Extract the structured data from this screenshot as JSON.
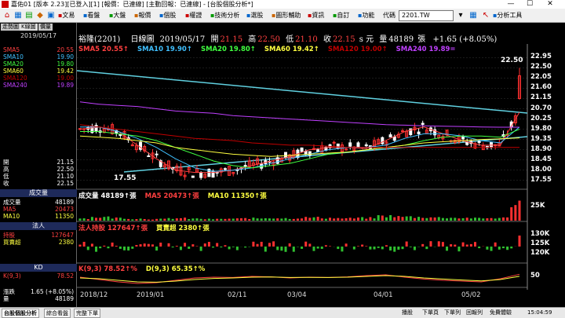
{
  "titlebar": {
    "title": "嘉佑01 [版本 2.23][已登入][1] [報價：已連線] [主動回報：已連線] - [台股個股分析*]",
    "min": "—",
    "max": "☐",
    "close": "✕"
  },
  "toolbar": {
    "menus": [
      "文易",
      "看盤",
      "大盤",
      "報價",
      "個股",
      "權證",
      "技術分析",
      "選股",
      "圖形輔助",
      "資訊",
      "自訂",
      "功能",
      "代碼"
    ],
    "code_value": "2201.TW",
    "analysis_tools": "分析工具"
  },
  "left": {
    "tabs": [
      "走勢圖",
      "K線圖",
      "價量"
    ],
    "date": "2019/05/17",
    "sma": [
      {
        "label": "SMA5",
        "value": "20.55",
        "color": "#ff4040"
      },
      {
        "label": "SMA10",
        "value": "19.90",
        "color": "#40c0ff"
      },
      {
        "label": "SMA20",
        "value": "19.80",
        "color": "#40ff40"
      },
      {
        "label": "SMA60",
        "value": "19.42",
        "color": "#ffff40"
      },
      {
        "label": "SMA120",
        "value": "19.00",
        "color": "#c00000"
      },
      {
        "label": "SMA240",
        "value": "19.89",
        "color": "#c040ff"
      }
    ],
    "ohlc": [
      {
        "label": "開",
        "value": "21.15"
      },
      {
        "label": "高",
        "value": "22.50"
      },
      {
        "label": "低",
        "value": "21.10"
      },
      {
        "label": "收",
        "value": "22.15"
      }
    ],
    "vol_head": "成交量",
    "vol_rows": [
      {
        "label": "成交量",
        "value": "48189",
        "color": "#ffffff"
      },
      {
        "label": "MA5",
        "value": "20473",
        "color": "#ff4040"
      },
      {
        "label": "MA10",
        "value": "11350",
        "color": "#ffff40"
      }
    ],
    "inst_head": "法人",
    "inst_rows": [
      {
        "label": "持股",
        "value": "127647",
        "color": "#ff4040"
      },
      {
        "label": "買賣超",
        "value": "2380",
        "color": "#ffff40"
      }
    ],
    "kd_head": "KD",
    "kd_rows": [
      {
        "label": "K(9,3)",
        "value": "78.52",
        "color": "#ff4040"
      }
    ],
    "bottom_rows": [
      {
        "label": "漲跌",
        "value": "1.65 (+8.05%)"
      },
      {
        "label": "量",
        "value": "48189"
      }
    ]
  },
  "chart_header": {
    "stock": "裕隆(2201)",
    "type": "日線圖",
    "date": "2019/05/17",
    "open_label": "開",
    "open": "21.15",
    "high_label": "高",
    "high": "22.50",
    "low_label": "低",
    "low": "21.10",
    "close_label": "收",
    "close": "22.15",
    "unit": "s 元",
    "vol_label": "量",
    "vol": "48189",
    "vol_unit": "張",
    "change": "+1.65 (+8.05%)"
  },
  "legends": {
    "sma": [
      {
        "text": "SMA5 20.55↑",
        "color": "#ff4040"
      },
      {
        "text": "SMA10 19.90↑",
        "color": "#40c0ff"
      },
      {
        "text": "SMA20 19.80↑",
        "color": "#40ff40"
      },
      {
        "text": "SMA60 19.42↑",
        "color": "#ffff40"
      },
      {
        "text": "SMA120 19.00↑",
        "color": "#c00000"
      },
      {
        "text": "SMA240 19.89=",
        "color": "#c040ff"
      }
    ],
    "vol": [
      {
        "text": "成交量 48189↑張",
        "color": "#ffffff"
      },
      {
        "text": "MA5 20473↑張",
        "color": "#ff4040"
      },
      {
        "text": "MA10 11350↑張",
        "color": "#ffff40"
      }
    ],
    "inst": [
      {
        "text": "法人持股 127647↑張",
        "color": "#ff4040"
      },
      {
        "text": "買賣超 2380↑張",
        "color": "#ffff40"
      }
    ],
    "kd": [
      {
        "text": "K(9,3) 78.52↑%",
        "color": "#ff4040"
      },
      {
        "text": "D(9,3) 65.35↑%",
        "color": "#ffff40"
      }
    ]
  },
  "annotations": {
    "peak": "22.50",
    "trough": "17.55"
  },
  "y_ticks": [
    "22.95",
    "22.50",
    "22.05",
    "21.60",
    "21.15",
    "20.70",
    "20.25",
    "19.80",
    "19.35",
    "18.90",
    "18.45",
    "18.00",
    "17.55"
  ],
  "vol_ticks": [
    "25K"
  ],
  "inst_ticks": [
    "130K",
    "125K",
    "120K"
  ],
  "kd_ticks": [
    "50"
  ],
  "x_ticks": [
    "2018/12",
    "2019/01",
    "02/11",
    "03/04",
    "04/01",
    "05/02"
  ],
  "statusbar": {
    "tabs": [
      "台股個股分析",
      "綜合看盤",
      "完整下單"
    ],
    "items": [
      "播股",
      "下單頁",
      "下單列",
      "回報列",
      "免費體驗",
      "15:04:59"
    ]
  },
  "chart_data": [
    {
      "type": "line",
      "title": "裕隆(2201) 日線圖",
      "ylim": [
        17.3,
        23.1
      ],
      "series": [
        {
          "name": "SMA5",
          "values": [
            19.8,
            19.9,
            19.7,
            19.1,
            18.5,
            18.0,
            17.9,
            17.9,
            18.0,
            18.2,
            18.4,
            18.6,
            18.9,
            19.0,
            19.0,
            18.95,
            19.3,
            19.7,
            19.9,
            19.6,
            19.3,
            19.1,
            19.1,
            20.55
          ]
        },
        {
          "name": "SMA10",
          "values": [
            19.9,
            19.9,
            19.7,
            19.4,
            19.0,
            18.5,
            18.1,
            17.95,
            18.0,
            18.1,
            18.3,
            18.5,
            18.7,
            18.9,
            19.0,
            19.0,
            19.1,
            19.4,
            19.6,
            19.6,
            19.5,
            19.3,
            19.2,
            19.9
          ]
        },
        {
          "name": "SMA20",
          "values": [
            19.7,
            19.7,
            19.6,
            19.5,
            19.3,
            19.0,
            18.7,
            18.4,
            18.2,
            18.1,
            18.2,
            18.3,
            18.5,
            18.7,
            18.8,
            18.9,
            19.0,
            19.1,
            19.3,
            19.45,
            19.5,
            19.5,
            19.45,
            19.8
          ]
        },
        {
          "name": "SMA60",
          "values": [
            19.5,
            19.45,
            19.4,
            19.3,
            19.2,
            19.0,
            18.9,
            18.8,
            18.7,
            18.65,
            18.6,
            18.65,
            18.7,
            18.75,
            18.8,
            18.9,
            19.0,
            19.1,
            19.2,
            19.25,
            19.3,
            19.35,
            19.38,
            19.42
          ]
        },
        {
          "name": "SMA120",
          "values": [
            20.0,
            19.9,
            19.8,
            19.7,
            19.6,
            19.5,
            19.4,
            19.35,
            19.3,
            19.2,
            19.15,
            19.1,
            19.1,
            19.05,
            19.0,
            19.0,
            19.0,
            19.0,
            19.0,
            19.0,
            19.0,
            19.0,
            19.0,
            19.0
          ]
        },
        {
          "name": "SMA240",
          "values": [
            21.0,
            20.9,
            20.85,
            20.8,
            20.7,
            20.6,
            20.55,
            20.5,
            20.4,
            20.35,
            20.3,
            20.25,
            20.2,
            20.15,
            20.1,
            20.05,
            20.0,
            19.98,
            19.95,
            19.93,
            19.92,
            19.9,
            19.89,
            19.89
          ]
        }
      ]
    },
    {
      "type": "bar",
      "title": "成交量",
      "series": [
        {
          "name": "成交量",
          "values": [
            6,
            9,
            7,
            5,
            4,
            6,
            5,
            4,
            5,
            6,
            7,
            6,
            8,
            7,
            6,
            7,
            12,
            10,
            9,
            8,
            7,
            6,
            7,
            48
          ]
        }
      ]
    },
    {
      "type": "line",
      "title": "KD",
      "ylim": [
        0,
        100
      ],
      "series": [
        {
          "name": "K(9,3)",
          "values": [
            60,
            45,
            30,
            20,
            25,
            40,
            55,
            60,
            58,
            65,
            62,
            55,
            60,
            58,
            62,
            70,
            75,
            60,
            48,
            40,
            35,
            30,
            50,
            78.52
          ]
        },
        {
          "name": "D(9,3)",
          "values": [
            55,
            50,
            40,
            30,
            28,
            35,
            45,
            52,
            55,
            60,
            61,
            58,
            59,
            58,
            60,
            65,
            70,
            65,
            55,
            48,
            42,
            36,
            45,
            65.35
          ]
        }
      ]
    }
  ]
}
